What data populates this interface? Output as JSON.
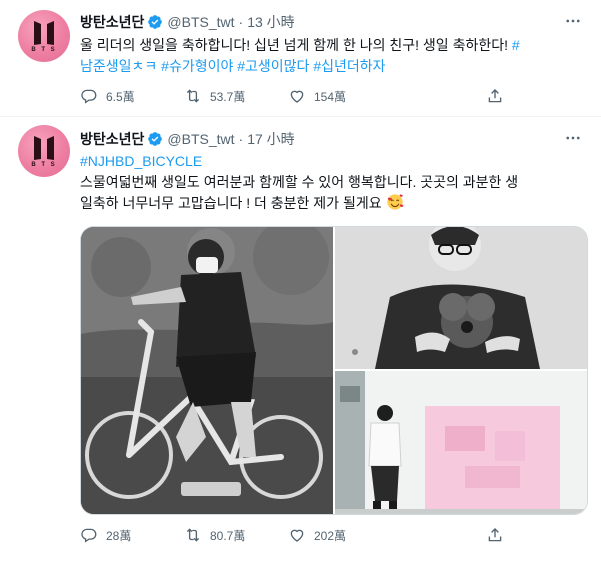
{
  "colors": {
    "accent": "#1d9bf0",
    "muted": "#536471",
    "avatar_pink": "#ee7fa2"
  },
  "avatar": {
    "text": "B T S"
  },
  "tweets": [
    {
      "name": "방탄소년단",
      "handle": "@BTS_twt",
      "dot": "·",
      "time": "13 小時",
      "text_line1": "울 리더의 생일을 축하합니다! 십년 넘게 함께 한 나의 친구! 생일 축하한다!",
      "hash_leading": "#",
      "hashtags": [
        "남준생일ㅊㅋ",
        "#슈가형이야",
        "#고생이많다",
        "#십년더하자"
      ],
      "reply": "6.5萬",
      "retweet": "53.7萬",
      "like": "154萬"
    },
    {
      "name": "방탄소년단",
      "handle": "@BTS_twt",
      "dot": "·",
      "time": "17 小時",
      "hashtag": "#NJHBD_BICYCLE",
      "text_line1": "스물여덟번째 생일도 여러분과 함께할 수 있어 행복합니다. 곳곳의 과분한 생",
      "text_line2": "일축하 너무너무 고맙습니다 ! 더 충분한 제가 될게요",
      "reply": "28萬",
      "retweet": "80.7萬",
      "like": "202萬"
    }
  ]
}
